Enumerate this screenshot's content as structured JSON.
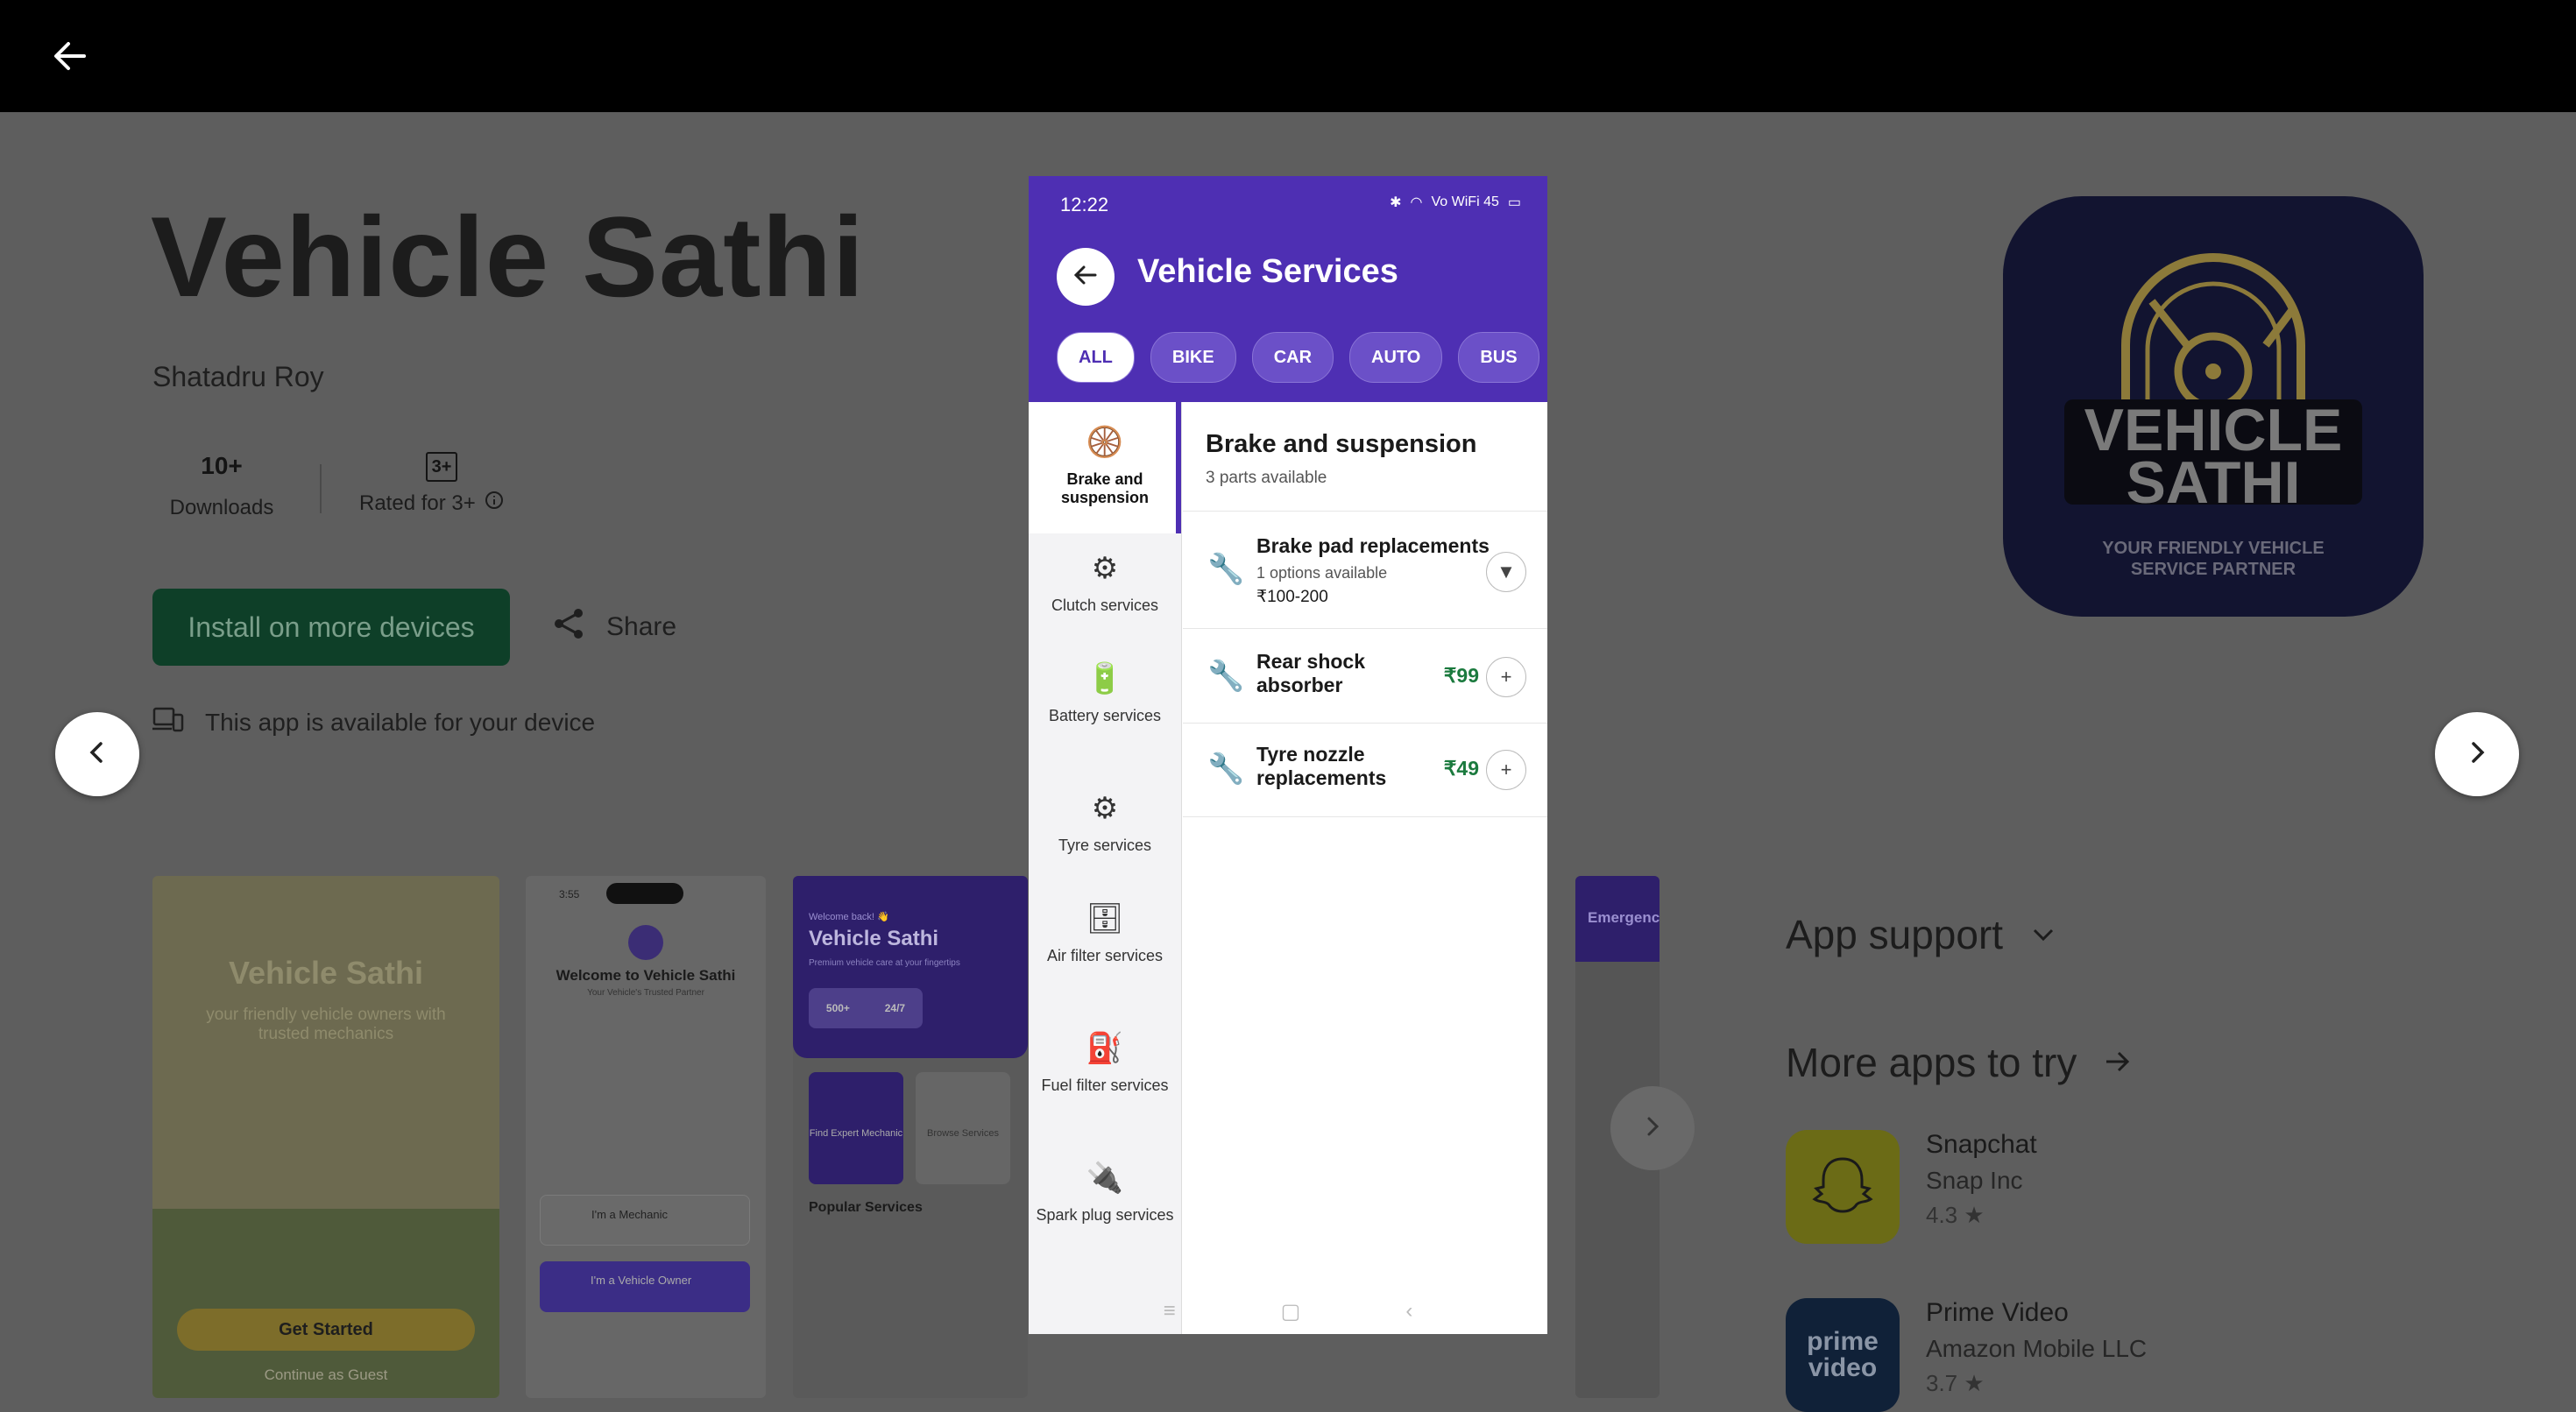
{
  "store": {
    "app_title": "Vehicle Sathi",
    "developer": "Shatadru Roy",
    "downloads_value": "10+",
    "downloads_label": "Downloads",
    "rating_badge": "3+",
    "rating_label": "Rated for 3+",
    "install_label": "Install on more devices",
    "share_label": "Share",
    "availability_text": "This app is available for your device"
  },
  "app_icon": {
    "line1": "VEHICLE",
    "line2": "SATHI",
    "tagline1": "YOUR FRIENDLY VEHICLE",
    "tagline2": "SERVICE PARTNER"
  },
  "thumbnails": {
    "t1_title": "Vehicle Sathi",
    "t1_subtitle": "your friendly vehicle owners with trusted mechanics",
    "t1_button": "Get Started",
    "t1_link": "Continue as Guest",
    "t2_time": "3:55",
    "t2_title": "Welcome to Vehicle Sathi",
    "t2_subtitle": "Your Vehicle's Trusted Partner",
    "t2_opt1": "I'm a Mechanic",
    "t2_opt2": "I'm a Vehicle Owner",
    "t3_welcome": "Welcome back! 👋",
    "t3_title": "Vehicle Sathi",
    "t3_subtitle": "Premium vehicle care at your fingertips",
    "t3_stat1": "500+",
    "t3_stat2": "24/7",
    "t3_card1": "Find Expert Mechanic",
    "t3_card2": "Browse Services",
    "t3_section": "Popular Services",
    "t6_title": "Emergenc"
  },
  "right_column": {
    "app_support": "App support",
    "more_apps": "More apps to try",
    "apps": [
      {
        "name": "Snapchat",
        "developer": "Snap Inc",
        "rating": "4.3 ★"
      },
      {
        "name": "Prime Video",
        "developer": "Amazon Mobile LLC",
        "rating": "3.7 ★"
      }
    ]
  },
  "phone": {
    "status_time": "12:22",
    "status_right": "Vo WiFi 45",
    "title": "Vehicle Services",
    "chips": [
      "ALL",
      "BIKE",
      "CAR",
      "AUTO",
      "BUS"
    ],
    "categories": [
      {
        "label": "Brake and suspension",
        "icon": "🛞"
      },
      {
        "label": "Clutch services",
        "icon": "⚙"
      },
      {
        "label": "Battery services",
        "icon": "🔋"
      },
      {
        "label": "Tyre services",
        "icon": "⚙"
      },
      {
        "label": "Air filter services",
        "icon": "🗄"
      },
      {
        "label": "Fuel filter services",
        "icon": "⛽"
      },
      {
        "label": "Spark plug services",
        "icon": "🔌"
      }
    ],
    "section_title": "Brake and suspension",
    "section_subtitle": "3 parts available",
    "parts": [
      {
        "name": "Brake pad replacements",
        "options": "1 options available",
        "range": "₹100-200",
        "price": "",
        "action": "▼"
      },
      {
        "name": "Rear shock absorber",
        "options": "",
        "range": "",
        "price": "₹99",
        "action": "+"
      },
      {
        "name": "Tyre nozzle replacements",
        "options": "",
        "range": "",
        "price": "₹49",
        "action": "+"
      }
    ]
  },
  "colors": {
    "phone_header": "#4e2fb3",
    "install_button": "#0e3f28",
    "price_green": "#1b7a3e"
  }
}
